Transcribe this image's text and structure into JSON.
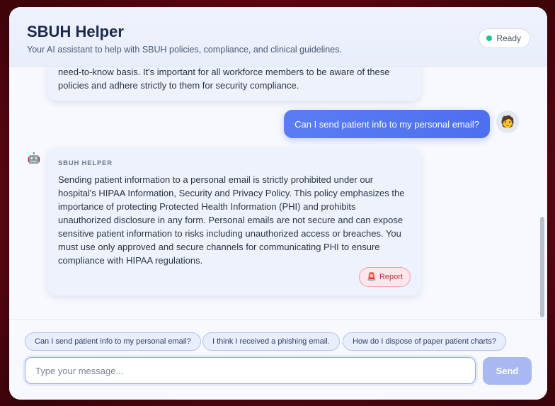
{
  "header": {
    "title": "SBUH Helper",
    "subtitle": "Your AI assistant to help with SBUH policies, compliance, and clinical guidelines.",
    "status": "Ready",
    "status_color": "#22c38e"
  },
  "messages": {
    "previous_bot_text": "need-to-know basis. It's important for all workforce members to be aware of these policies and adhere strictly to them for security compliance.",
    "user_text": "Can I send patient info to my personal email?",
    "bot_label": "SBUH HELPER",
    "bot_text": "Sending patient information to a personal email is strictly prohibited under our hospital's HIPAA Information, Security and Privacy Policy. This policy emphasizes the importance of protecting Protected Health Information (PHI) and prohibits unauthorized disclosure in any form. Personal emails are not secure and can expose sensitive patient information to risks including unauthorized access or breaches. You must use only approved and secure channels for communicating PHI to ensure compliance with HIPAA regulations.",
    "report_label": "Report",
    "report_icon": "🚨",
    "user_avatar": "🧑",
    "bot_avatar": "🤖"
  },
  "suggestions": [
    "Can I send patient info to my personal email?",
    "I think I received a phishing email.",
    "How do I dispose of paper patient charts?"
  ],
  "composer": {
    "placeholder": "Type your message...",
    "send_label": "Send"
  },
  "colors": {
    "accent": "#4d6ff0",
    "send_disabled": "#a8b8f0",
    "report": "#b8323f"
  }
}
